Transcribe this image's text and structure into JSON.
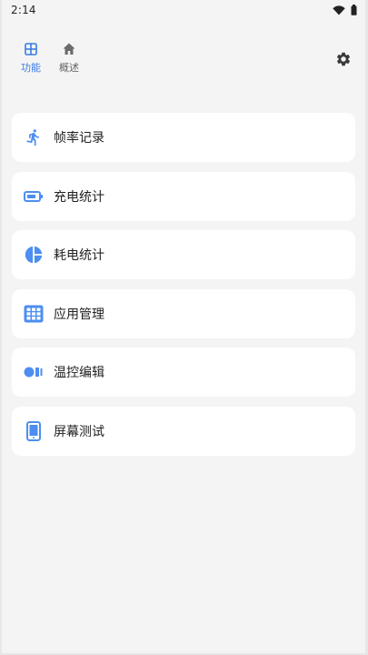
{
  "status_bar": {
    "time": "2:14",
    "icons": [
      "wifi-icon",
      "battery-icon"
    ]
  },
  "top_tabs": [
    {
      "label": "功能",
      "icon": "grid-icon",
      "active": true
    },
    {
      "label": "概述",
      "icon": "home-icon",
      "active": false
    }
  ],
  "settings": {
    "icon": "gear-icon"
  },
  "cards": [
    {
      "label": "帧率记录",
      "icon": "running-person-icon"
    },
    {
      "label": "充电统计",
      "icon": "battery-icon"
    },
    {
      "label": "耗电统计",
      "icon": "pie-chart-icon"
    },
    {
      "label": "应用管理",
      "icon": "apps-grid-icon"
    },
    {
      "label": "温控编辑",
      "icon": "thermal-control-icon"
    },
    {
      "label": "屏幕测试",
      "icon": "phone-icon"
    }
  ],
  "colors": {
    "accent": "#3b7de0",
    "icon_blue": "#4d8ef0",
    "background": "#f4f4f4",
    "card": "#ffffff",
    "inactive_text": "#666666"
  }
}
